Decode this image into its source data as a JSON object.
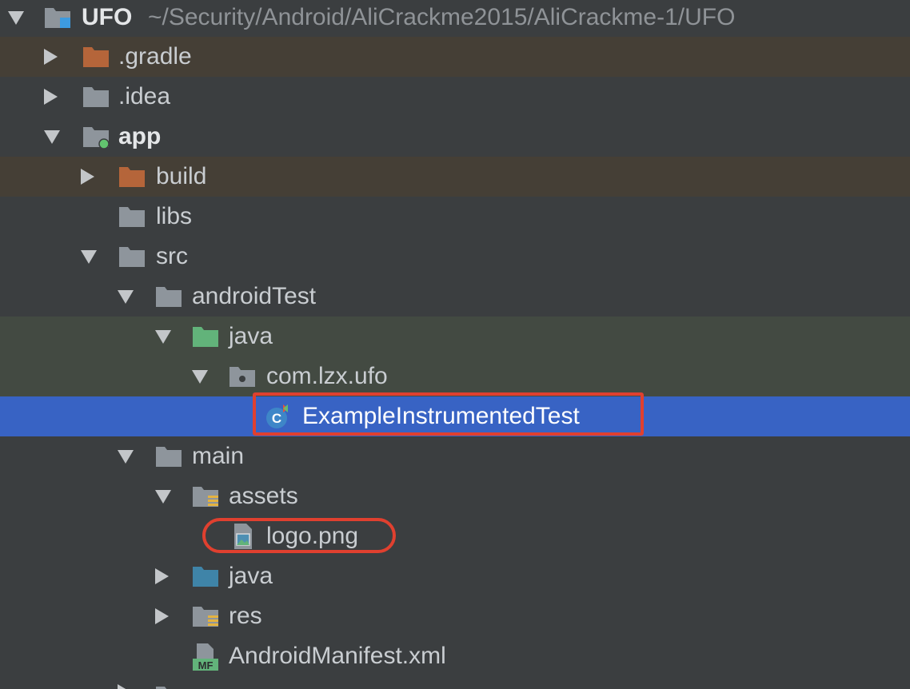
{
  "project": {
    "name": "UFO",
    "path": "~/Security/Android/AliCrackme2015/AliCrackme-1/UFO"
  },
  "rows": [
    {
      "label": "UFO",
      "arrow": "down",
      "icon": "project-module-folder-icon"
    },
    {
      "label": ".gradle",
      "arrow": "right",
      "icon": "excluded-folder-icon"
    },
    {
      "label": ".idea",
      "arrow": "right",
      "icon": "folder-icon"
    },
    {
      "label": "app",
      "arrow": "down",
      "icon": "android-module-folder-icon"
    },
    {
      "label": "build",
      "arrow": "right",
      "icon": "excluded-folder-icon"
    },
    {
      "label": "libs",
      "arrow": "none",
      "icon": "folder-icon"
    },
    {
      "label": "src",
      "arrow": "down",
      "icon": "folder-icon"
    },
    {
      "label": "androidTest",
      "arrow": "down",
      "icon": "folder-icon"
    },
    {
      "label": "java",
      "arrow": "down",
      "icon": "test-source-folder-icon"
    },
    {
      "label": "com.lzx.ufo",
      "arrow": "down",
      "icon": "package-icon"
    },
    {
      "label": "ExampleInstrumentedTest",
      "arrow": "none",
      "icon": "test-class-icon"
    },
    {
      "label": "main",
      "arrow": "down",
      "icon": "folder-icon"
    },
    {
      "label": "assets",
      "arrow": "down",
      "icon": "resource-folder-icon"
    },
    {
      "label": "logo.png",
      "arrow": "none",
      "icon": "image-file-icon"
    },
    {
      "label": "java",
      "arrow": "right",
      "icon": "source-folder-icon"
    },
    {
      "label": "res",
      "arrow": "right",
      "icon": "resource-folder-icon"
    },
    {
      "label": "AndroidManifest.xml",
      "arrow": "none",
      "icon": "manifest-file-icon"
    }
  ],
  "colors": {
    "background": "#3b3e40",
    "excluded_row": "#453f36",
    "test_row": "#434a42",
    "selected_row": "#3863c4",
    "highlight": "#e0402f",
    "folder": "#8e959c",
    "excluded_folder": "#b5653a",
    "test_folder": "#62b37a",
    "source_folder": "#3f84a8"
  },
  "selected_item": "ExampleInstrumentedTest",
  "annotated_items": [
    "ExampleInstrumentedTest",
    "logo.png"
  ]
}
